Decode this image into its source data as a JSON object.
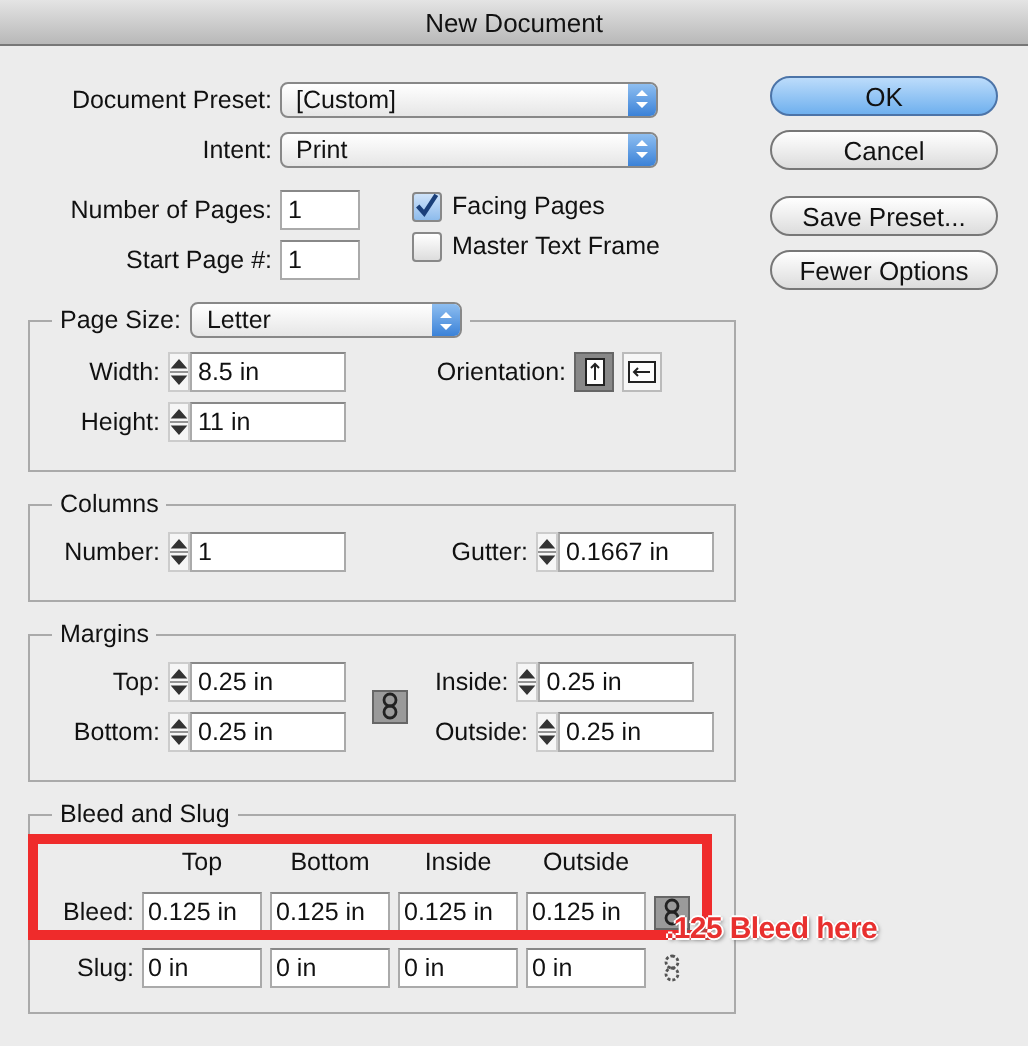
{
  "window": {
    "title": "New Document"
  },
  "document_preset": {
    "label": "Document Preset:",
    "value": "[Custom]"
  },
  "intent": {
    "label": "Intent:",
    "value": "Print"
  },
  "number_of_pages": {
    "label": "Number of Pages:",
    "value": "1"
  },
  "start_page": {
    "label": "Start Page #:",
    "value": "1"
  },
  "facing_pages": {
    "label": "Facing Pages",
    "checked": true
  },
  "master_text_frame": {
    "label": "Master Text Frame",
    "checked": false
  },
  "buttons": [
    {
      "label": "OK",
      "default": true
    },
    {
      "label": "Cancel",
      "default": false
    },
    {
      "label": "Save Preset...",
      "default": false
    },
    {
      "label": "Fewer Options",
      "default": false
    }
  ],
  "page_size": {
    "title": "Page Size:",
    "value": "Letter",
    "fields": [
      {
        "label": "Width:",
        "value": "8.5 in"
      },
      {
        "label": "Height:",
        "value": "11 in"
      }
    ],
    "orientation_label": "Orientation:",
    "orientation": [
      {
        "kind": "portrait",
        "selected": true
      },
      {
        "kind": "landscape",
        "selected": false
      }
    ]
  },
  "columns": {
    "title": "Columns",
    "number": {
      "label": "Number:",
      "value": "1"
    },
    "gutter": {
      "label": "Gutter:",
      "value": "0.1667 in"
    }
  },
  "margins": {
    "title": "Margins",
    "left": [
      {
        "label": "Top:",
        "value": "0.25 in"
      },
      {
        "label": "Bottom:",
        "value": "0.25 in"
      }
    ],
    "right": [
      {
        "label": "Inside:",
        "value": "0.25 in"
      },
      {
        "label": "Outside:",
        "value": "0.25 in"
      }
    ]
  },
  "bleed_and_slug": {
    "title": "Bleed and Slug",
    "headers": [
      "Top",
      "Bottom",
      "Inside",
      "Outside"
    ],
    "rows": [
      {
        "label": "Bleed:",
        "values": [
          "0.125 in",
          "0.125 in",
          "0.125 in",
          "0.125 in"
        ],
        "linked": true
      },
      {
        "label": "Slug:",
        "values": [
          "0 in",
          "0 in",
          "0 in",
          "0 in"
        ],
        "linked": false
      }
    ]
  },
  "annotation": {
    "text": ".125 Bleed here"
  }
}
